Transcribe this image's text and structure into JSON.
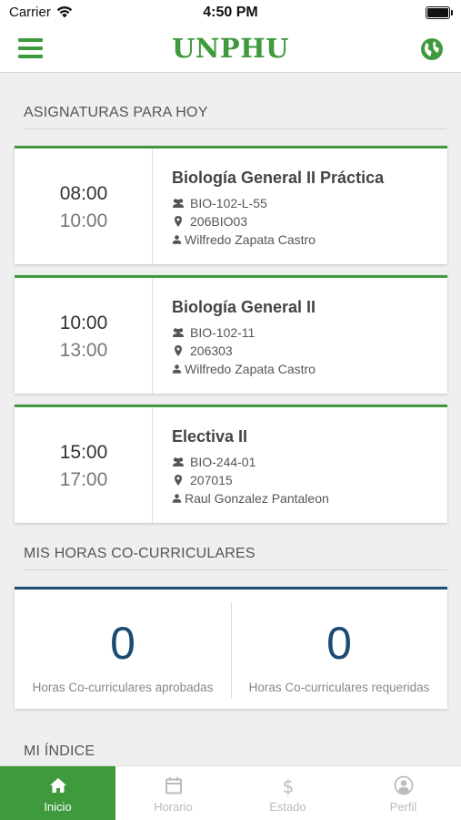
{
  "status_bar": {
    "carrier": "Carrier",
    "time": "4:50 PM"
  },
  "nav": {
    "title": "UNPHU",
    "brand_color": "#3e9a3c"
  },
  "sections": {
    "today": "ASIGNATURAS PARA HOY",
    "cocurricular": "MIS HORAS CO-CURRICULARES",
    "index": "MI ÍNDICE"
  },
  "courses": [
    {
      "start": "08:00",
      "end": "10:00",
      "name": "Biología General II Práctica",
      "group": "BIO-102-L-55",
      "room": "206BIO03",
      "professor": "Wilfredo Zapata Castro"
    },
    {
      "start": "10:00",
      "end": "13:00",
      "name": "Biología General II",
      "group": "BIO-102-11",
      "room": "206303",
      "professor": "Wilfredo Zapata Castro"
    },
    {
      "start": "15:00",
      "end": "17:00",
      "name": "Electiva II",
      "group": "BIO-244-01",
      "room": "207015",
      "professor": "Raul Gonzalez Pantaleon"
    }
  ],
  "cocurricular": {
    "approved_value": "0",
    "approved_label": "Horas Co-curriculares aprobadas",
    "required_value": "0",
    "required_label": "Horas Co-curriculares requeridas",
    "accent_color": "#1b4a72"
  },
  "tabs": [
    {
      "label": "Inicio",
      "icon": "home-icon",
      "active": true
    },
    {
      "label": "Horario",
      "icon": "calendar-icon",
      "active": false
    },
    {
      "label": "Estado",
      "icon": "dollar-icon",
      "active": false
    },
    {
      "label": "Perfil",
      "icon": "user-circle-icon",
      "active": false
    }
  ]
}
